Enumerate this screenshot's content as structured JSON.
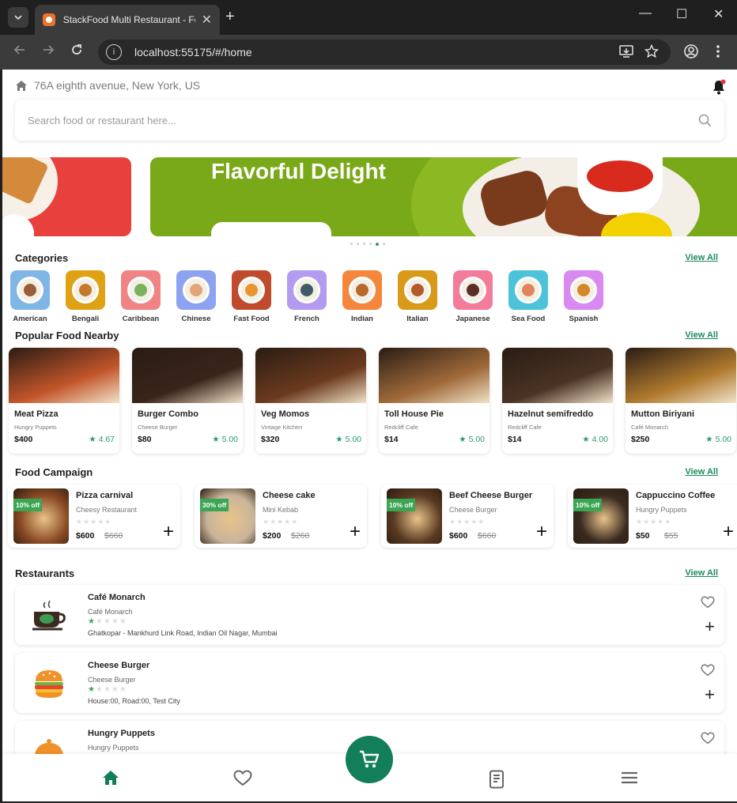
{
  "browser": {
    "tab_title": "StackFood Multi Restaurant - Fo",
    "url": "localhost:55175/#/home",
    "new_tab_glyph": "+",
    "close_glyph": "✕",
    "minimize_glyph": "—",
    "maximize_glyph": "☐",
    "window_close_glyph": "✕"
  },
  "header": {
    "address": "76A eighth avenue, New York, US",
    "search_placeholder": "Search food or restaurant here..."
  },
  "banner": {
    "title": "Flavorful Delight",
    "slide_count": 6,
    "active_slide": 4
  },
  "categories": {
    "title": "Categories",
    "view_all": "View All",
    "items": [
      {
        "label": "American",
        "bg": "#7fb6e6",
        "food": "#9a5c3a"
      },
      {
        "label": "Bengali",
        "bg": "#e0a215",
        "food": "#c47a2a"
      },
      {
        "label": "Caribbean",
        "bg": "#f08484",
        "food": "#79b25c"
      },
      {
        "label": "Chinese",
        "bg": "#8ea2f2",
        "food": "#e4a47a"
      },
      {
        "label": "Fast Food",
        "bg": "#c04a2c",
        "food": "#e6962d"
      },
      {
        "label": "French",
        "bg": "#b39bf0",
        "food": "#3f5c66"
      },
      {
        "label": "Indian",
        "bg": "#f5873d",
        "food": "#b86a2a"
      },
      {
        "label": "Italian",
        "bg": "#d89a18",
        "food": "#b25a2c"
      },
      {
        "label": "Japanese",
        "bg": "#f27c9a",
        "food": "#5a3026"
      },
      {
        "label": "Sea Food",
        "bg": "#4cc3d9",
        "food": "#e0855a"
      },
      {
        "label": "Spanish",
        "bg": "#d98af0",
        "food": "#d4862a"
      }
    ]
  },
  "popular": {
    "title": "Popular Food Nearby",
    "view_all": "View All",
    "items": [
      {
        "name": "Meat Pizza",
        "restaurant": "Hungry Puppets",
        "price": "$400",
        "rating": "4.67",
        "color": "#c2552a"
      },
      {
        "name": "Burger Combo",
        "restaurant": "Cheese Burger",
        "price": "$80",
        "rating": "5.00",
        "color": "#3a241a"
      },
      {
        "name": "Veg Momos",
        "restaurant": "Vintage Kitchen",
        "price": "$320",
        "rating": "5.00",
        "color": "#6b3a1d"
      },
      {
        "name": "Toll House Pie",
        "restaurant": "Redcliff Cafe",
        "price": "$14",
        "rating": "5.00",
        "color": "#a06a3a"
      },
      {
        "name": "Hazelnut semifreddo",
        "restaurant": "Redcliff Cafe",
        "price": "$14",
        "rating": "4.00",
        "color": "#4a3324"
      },
      {
        "name": "Mutton Biriyani",
        "restaurant": "Café Monarch",
        "price": "$250",
        "rating": "5.00",
        "color": "#b07a2e"
      }
    ]
  },
  "campaign": {
    "title": "Food Campaign",
    "view_all": "View All",
    "items": [
      {
        "name": "Pizza carnival",
        "restaurant": "Cheesy Restaurant",
        "discount": "10% off",
        "price": "$600",
        "old_price": "$660",
        "color": "#8a4a24"
      },
      {
        "name": "Cheese cake",
        "restaurant": "Mini Kebab",
        "discount": "30% off",
        "price": "$200",
        "old_price": "$260",
        "color": "#c8b49a"
      },
      {
        "name": "Beef Cheese Burger",
        "restaurant": "Cheese Burger",
        "discount": "10% off",
        "price": "$600",
        "old_price": "$660",
        "color": "#5a3a22"
      },
      {
        "name": "Cappuccino Coffee",
        "restaurant": "Hungry Puppets",
        "discount": "10% off",
        "price": "$50",
        "old_price": "$55",
        "color": "#3a2a20"
      }
    ]
  },
  "restaurants": {
    "title": "Restaurants",
    "view_all": "View All",
    "items": [
      {
        "name": "Café Monarch",
        "subtitle": "Café Monarch",
        "rating": 1,
        "address": "Ghatkopar - Mankhurd Link Road, Indian Oil Nagar, Mumbai",
        "logo": "coffee-cup"
      },
      {
        "name": "Cheese Burger",
        "subtitle": "Cheese Burger",
        "rating": 1,
        "address": "House:00, Road:00, Test City",
        "logo": "burger"
      },
      {
        "name": "Hungry Puppets",
        "subtitle": "Hungry Puppets",
        "rating": 0,
        "address": "",
        "logo": "cloche"
      }
    ]
  },
  "bottom_nav": {
    "items": [
      "home",
      "favourite",
      "cart",
      "orders",
      "menu"
    ],
    "active": "home"
  },
  "colors": {
    "primary": "#127e5a",
    "accent_green": "#3aa552",
    "view_all": "#1d8a5e"
  }
}
